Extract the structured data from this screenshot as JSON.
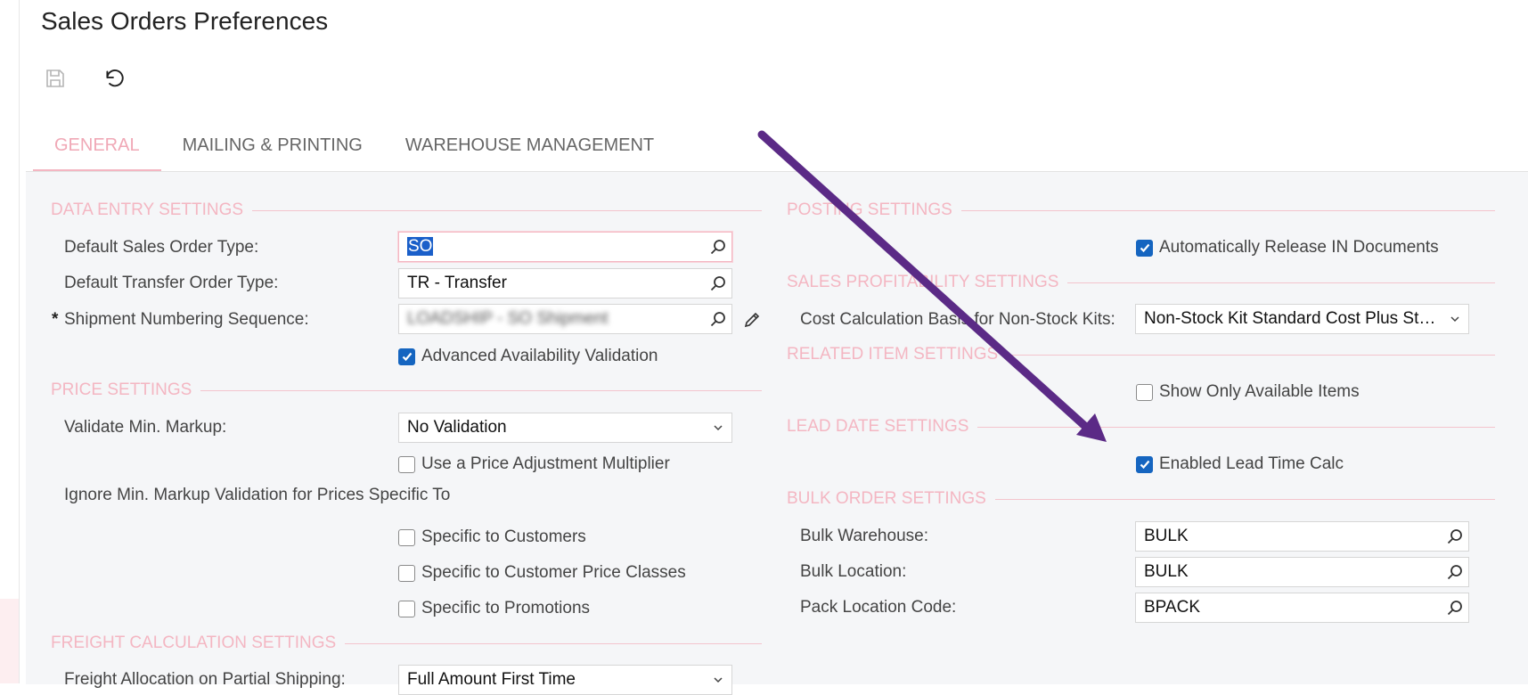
{
  "page": {
    "title": "Sales Orders Preferences"
  },
  "toolbar": {
    "save_icon": "save-icon",
    "undo_icon": "undo-icon"
  },
  "tabs": [
    {
      "label": "GENERAL",
      "active": true
    },
    {
      "label": "MAILING & PRINTING",
      "active": false
    },
    {
      "label": "WAREHOUSE MANAGEMENT",
      "active": false
    }
  ],
  "data_entry": {
    "title": "DATA ENTRY SETTINGS",
    "default_so_type_label": "Default Sales Order Type:",
    "default_so_type_value": "SO",
    "default_transfer_label": "Default Transfer Order Type:",
    "default_transfer_value": "TR - Transfer",
    "shipment_seq_required": "*",
    "shipment_seq_label": "Shipment Numbering Sequence:",
    "shipment_seq_value": "LOADSHIP - SO Shipment",
    "advanced_availability_label": "Advanced Availability Validation",
    "advanced_availability_checked": true
  },
  "price": {
    "title": "PRICE SETTINGS",
    "validate_markup_label": "Validate Min. Markup:",
    "validate_markup_value": "No Validation",
    "price_adj_label": "Use a Price Adjustment Multiplier",
    "price_adj_checked": false,
    "ignore_label": "Ignore Min. Markup Validation for Prices Specific To",
    "specific_customers_label": "Specific to Customers",
    "specific_customers_checked": false,
    "specific_classes_label": "Specific to Customer Price Classes",
    "specific_classes_checked": false,
    "specific_promos_label": "Specific to Promotions",
    "specific_promos_checked": false
  },
  "freight": {
    "title": "FREIGHT CALCULATION SETTINGS",
    "allocation_label": "Freight Allocation on Partial Shipping:",
    "allocation_value": "Full Amount First Time"
  },
  "posting": {
    "title": "POSTING SETTINGS",
    "auto_release_label": "Automatically Release IN Documents",
    "auto_release_checked": true
  },
  "profitability": {
    "title": "SALES PROFITABILITY SETTINGS",
    "cost_calc_label": "Cost Calculation Basis for Non-Stock Kits:",
    "cost_calc_value": "Non-Stock Kit Standard Cost Plus Stock Components"
  },
  "related": {
    "title": "RELATED ITEM SETTINGS",
    "show_available_label": "Show Only Available Items",
    "show_available_checked": false
  },
  "lead_date": {
    "title": "LEAD DATE SETTINGS",
    "enabled_label": "Enabled Lead Time Calc",
    "enabled_checked": true
  },
  "bulk": {
    "title": "BULK ORDER SETTINGS",
    "warehouse_label": "Bulk Warehouse:",
    "warehouse_value": "BULK",
    "location_label": "Bulk Location:",
    "location_value": "BULK",
    "pack_label": "Pack Location Code:",
    "pack_value": "BPACK"
  },
  "annotation": {
    "arrow_color": "#5b2a86"
  },
  "colors": {
    "accent": "#f4b6c2",
    "checkbox": "#1565c0"
  }
}
